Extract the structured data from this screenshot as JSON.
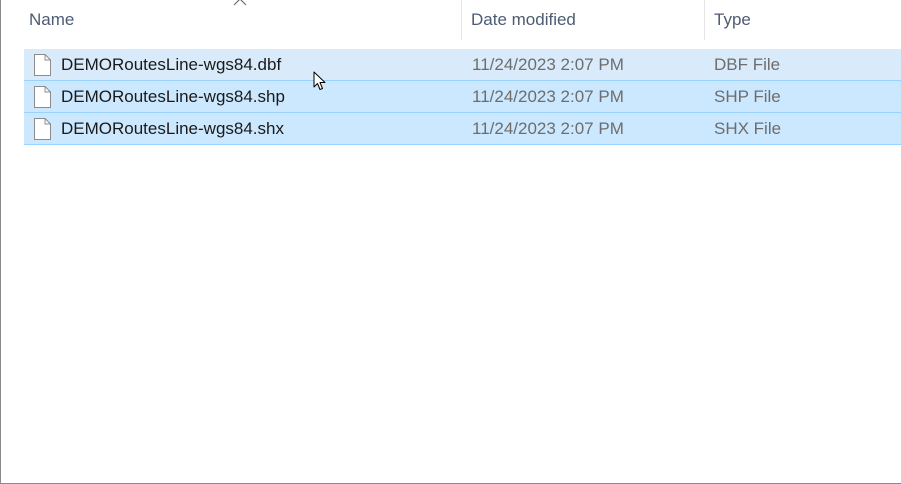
{
  "columns": {
    "name": "Name",
    "date_modified": "Date modified",
    "type": "Type"
  },
  "sort": {
    "column": "Name",
    "indicator": "chevron-up-icon"
  },
  "files": [
    {
      "name": "DEMORoutesLine-wgs84.dbf",
      "date_modified": "11/24/2023 2:07 PM",
      "type": "DBF File",
      "selected": true,
      "hovered": true
    },
    {
      "name": "DEMORoutesLine-wgs84.shp",
      "date_modified": "11/24/2023 2:07 PM",
      "type": "SHP File",
      "selected": true,
      "hovered": false
    },
    {
      "name": "DEMORoutesLine-wgs84.shx",
      "date_modified": "11/24/2023 2:07 PM",
      "type": "SHX File",
      "selected": true,
      "hovered": false
    }
  ],
  "colors": {
    "selection": "#cce8ff",
    "selection_hover": "#d9ebfb",
    "header_text": "#4d5b73"
  },
  "icons": {
    "file": "file-icon",
    "cursor": "mouse-pointer-icon"
  }
}
